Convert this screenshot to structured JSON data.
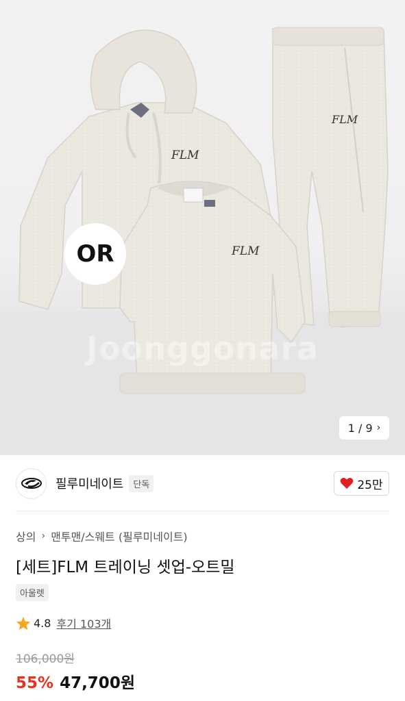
{
  "gallery": {
    "badge": "OR",
    "watermark": "Joonggonara",
    "counter": "1 / 9",
    "logo_mark": "FLM"
  },
  "brand": {
    "name": "필루미네이트",
    "tag": "단독",
    "likes": "25만",
    "logo_icon": "brand-logo-icon",
    "like_icon": "heart-icon"
  },
  "breadcrumb": {
    "items": [
      "상의",
      "맨투맨/스웨트 (필루미네이트)"
    ]
  },
  "product": {
    "title": "[세트]FLM 트레이닝 셋업-오트밀",
    "outlet_tag": "아울렛",
    "rating": "4.8",
    "reviews": "후기 103개",
    "original_price": "106,000원",
    "discount": "55%",
    "price": "47,700원"
  },
  "colors": {
    "accent_red": "#e8311e",
    "heart_red": "#e02020",
    "star_orange": "#f5a623",
    "garment_oatmeal": "#ebe8e0"
  }
}
